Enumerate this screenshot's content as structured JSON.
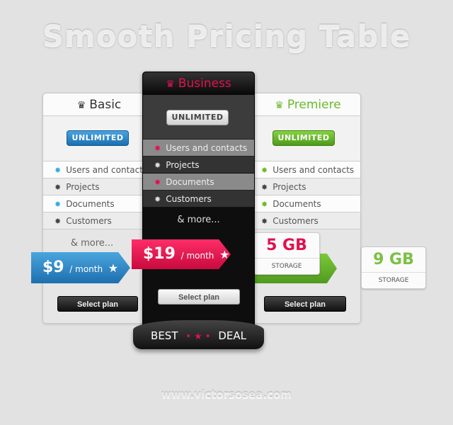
{
  "title": "Smooth Pricing Table",
  "footer": "www.victorsosea.com",
  "colors": {
    "basic": "#2a86c6",
    "business": "#e0124f",
    "premiere": "#6ab92c"
  },
  "features": [
    "Users and contacts",
    "Projects",
    "Documents",
    "Customers"
  ],
  "more": "& more...",
  "plans": [
    {
      "name": "Basic",
      "badge": "UNLIMITED",
      "price": "$9",
      "period": "/ month",
      "button": "Select plan"
    },
    {
      "name": "Business",
      "badge": "UNLIMITED",
      "price": "$19",
      "period": "/ month",
      "button": "Select plan",
      "ribbon": {
        "left": "BEST",
        "right": "DEAL"
      }
    },
    {
      "name": "Premiere",
      "badge": "UNLIMITED",
      "button": "Select plan"
    }
  ],
  "storage": [
    {
      "value": "5 GB",
      "label": "STORAGE"
    },
    {
      "value": "9 GB",
      "label": "STORAGE"
    }
  ]
}
